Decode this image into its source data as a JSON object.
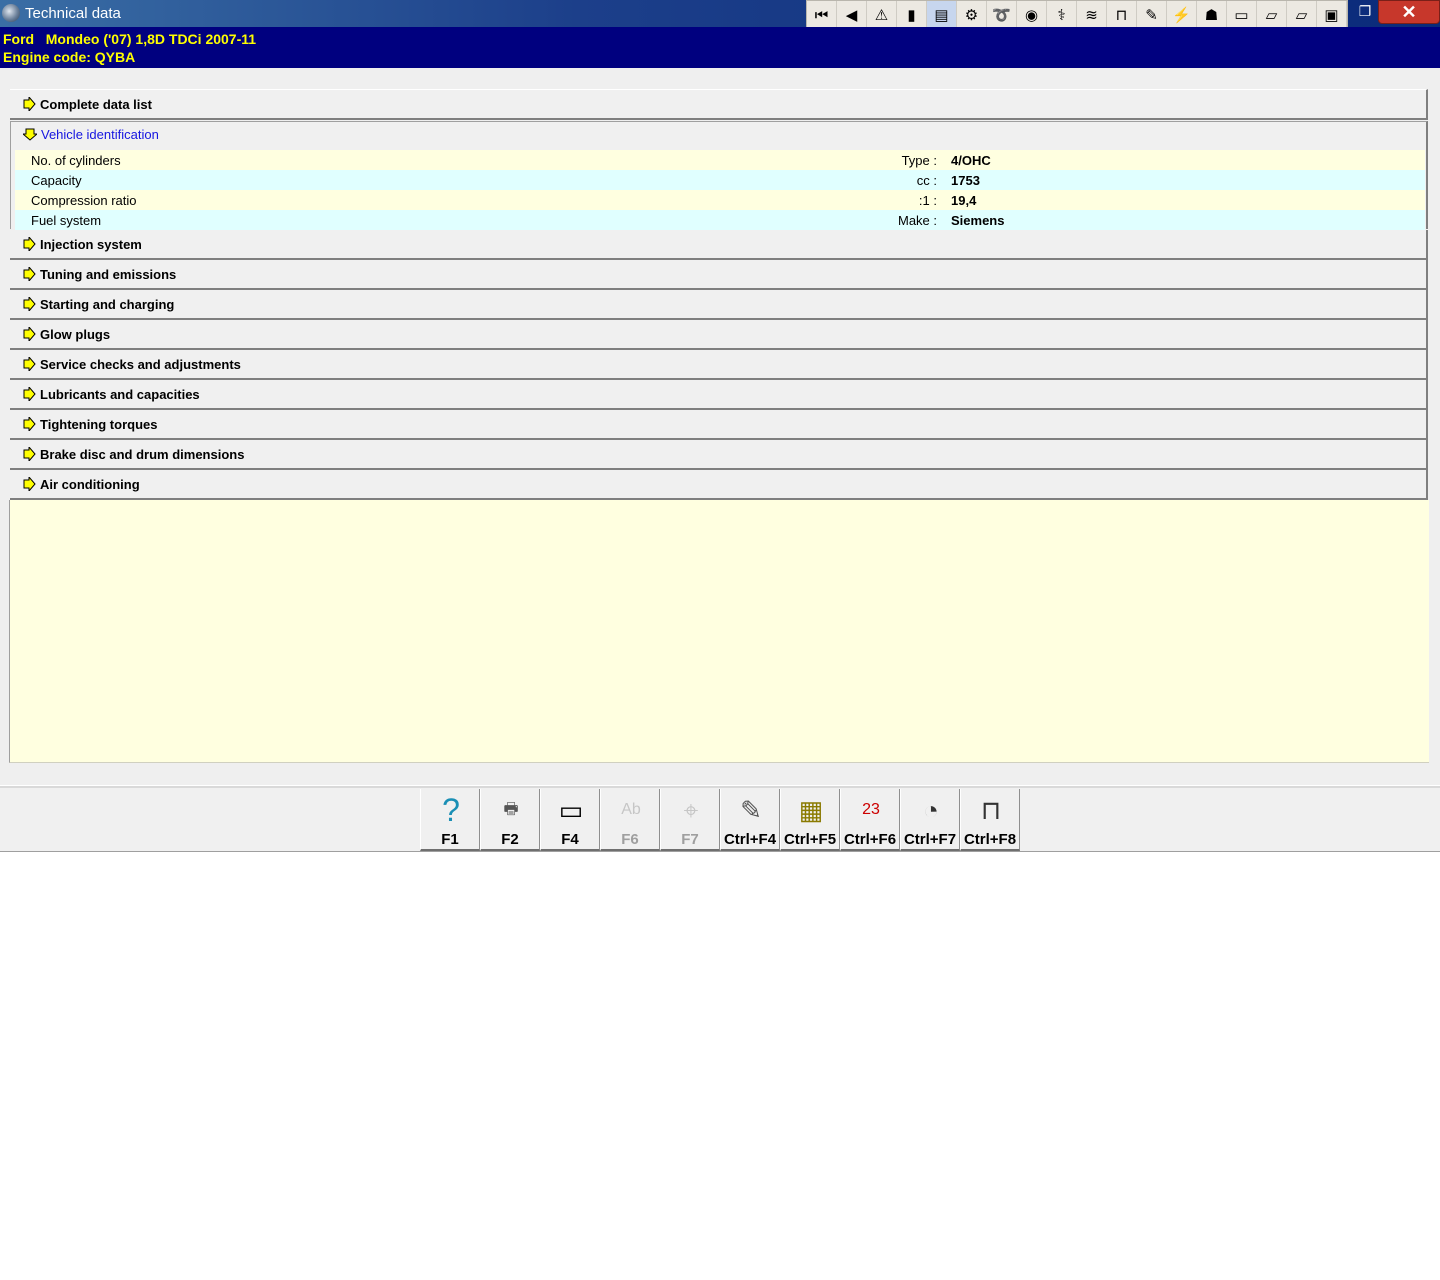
{
  "window": {
    "title": "Technical data",
    "restore_glyph": "❐",
    "close_glyph": "✕"
  },
  "toolbar": [
    {
      "name": "first-icon",
      "glyph": "⏮"
    },
    {
      "name": "back-icon",
      "glyph": "◀"
    },
    {
      "name": "warning-icon",
      "glyph": "⚠"
    },
    {
      "name": "color-bars-icon",
      "glyph": "▮"
    },
    {
      "name": "engine-map-icon",
      "glyph": "▤"
    },
    {
      "name": "gear-icon",
      "glyph": "⚙"
    },
    {
      "name": "belt-icon",
      "glyph": "➰"
    },
    {
      "name": "speedometer-icon",
      "glyph": "◉"
    },
    {
      "name": "diagnostics-icon",
      "glyph": "⚕"
    },
    {
      "name": "emissions-icon",
      "glyph": "≋"
    },
    {
      "name": "lift-icon",
      "glyph": "⊓"
    },
    {
      "name": "parts-icon",
      "glyph": "✎"
    },
    {
      "name": "fuse-icon",
      "glyph": "⚡"
    },
    {
      "name": "relay-icon",
      "glyph": "☗"
    },
    {
      "name": "car-outline-icon",
      "glyph": "▭"
    },
    {
      "name": "car-disabled-icon",
      "glyph": "▱"
    },
    {
      "name": "car-dim-icon",
      "glyph": "▱"
    },
    {
      "name": "car-red-icon",
      "glyph": "▣"
    }
  ],
  "vehicle": {
    "line1": "Ford   Mondeo ('07) 1,8D TDCi 2007-11",
    "line2": "Engine code: QYBA"
  },
  "sections": {
    "complete": "Complete data list",
    "vehicle_identification": {
      "label": "Vehicle identification",
      "rows": [
        {
          "name": "No. of cylinders",
          "unit": "Type :",
          "value": "4/OHC"
        },
        {
          "name": "Capacity",
          "unit": "cc :",
          "value": "1753"
        },
        {
          "name": "Compression ratio",
          "unit": ":1 :",
          "value": "19,4"
        },
        {
          "name": "Fuel system",
          "unit": "Make :",
          "value": "Siemens"
        }
      ]
    },
    "collapsed": [
      "Injection system",
      "Tuning and emissions",
      "Starting and charging",
      "Glow plugs",
      "Service checks and adjustments",
      "Lubricants and capacities",
      "Tightening torques",
      "Brake disc and drum dimensions",
      "Air conditioning"
    ]
  },
  "function_keys": [
    {
      "key": "F1",
      "icon": "help-icon",
      "glyph": "?",
      "enabled": true,
      "color": "#1a8fb5"
    },
    {
      "key": "F2",
      "icon": "printer-icon",
      "glyph": "🖶",
      "enabled": true,
      "color": "#555555"
    },
    {
      "key": "F4",
      "icon": "screen-icon",
      "glyph": "▭",
      "enabled": true,
      "color": "#000000"
    },
    {
      "key": "F6",
      "icon": "font-icon",
      "glyph": "Ab",
      "enabled": false,
      "color": "#888888"
    },
    {
      "key": "F7",
      "icon": "zoom-icon",
      "glyph": "⌖",
      "enabled": false,
      "color": "#888888"
    },
    {
      "key": "Ctrl+F4",
      "icon": "notes-icon",
      "glyph": "✎",
      "enabled": true,
      "color": "#555555"
    },
    {
      "key": "Ctrl+F5",
      "icon": "table-add-icon",
      "glyph": "▦",
      "enabled": true,
      "color": "#8a7a00"
    },
    {
      "key": "Ctrl+F6",
      "icon": "steps-icon",
      "glyph": "23",
      "enabled": true,
      "color": "#cc0000"
    },
    {
      "key": "Ctrl+F7",
      "icon": "gauges-icon",
      "glyph": "◔",
      "enabled": true,
      "color": "#333333"
    },
    {
      "key": "Ctrl+F8",
      "icon": "lift-car-icon",
      "glyph": "⊓",
      "enabled": true,
      "color": "#333333"
    }
  ]
}
